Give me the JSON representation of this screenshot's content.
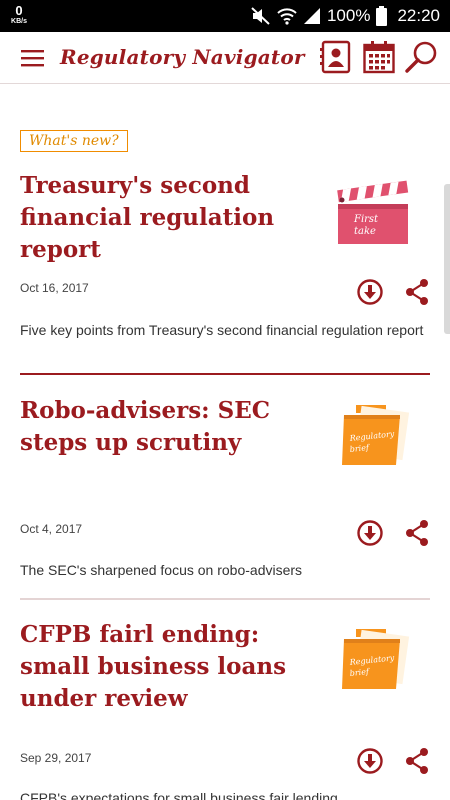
{
  "status_bar": {
    "speed_value": "0",
    "speed_unit": "KB/s",
    "battery": "100%",
    "time": "22:20"
  },
  "app_bar": {
    "title": "Regulatory Navigator",
    "icons": [
      "menu-icon",
      "contacts-icon",
      "calendar-icon",
      "search-icon"
    ]
  },
  "feed": {
    "badge": "What's new?",
    "articles": [
      {
        "title": "Treasury's second financial regulation report",
        "date": "Oct 16, 2017",
        "summary": "Five key points from Treasury's second financial regulation report",
        "thumbnail": {
          "type": "clapperboard",
          "text_line1": "First",
          "text_line2": "take",
          "color": "#e0516e"
        }
      },
      {
        "title": "Robo-advisers: SEC steps up scrutiny",
        "date": "Oct 4, 2017",
        "summary": "The SEC's sharpened focus on robo-advisers",
        "thumbnail": {
          "type": "folder",
          "text_line1": "Regulatory",
          "text_line2": "brief",
          "color": "#f7941d"
        }
      },
      {
        "title": "CFPB fairl ending: small business loans under review",
        "date": "Sep 29, 2017",
        "summary": "CFPB's expectations for small business fair lending",
        "thumbnail": {
          "type": "folder",
          "text_line1": "Regulatory",
          "text_line2": "brief",
          "color": "#f7941d"
        }
      }
    ]
  },
  "colors": {
    "accent": "#9b1b1f",
    "badge": "#f08c00",
    "divider_strong": "#9b1b1f",
    "divider_light": "#c9a9a9"
  }
}
